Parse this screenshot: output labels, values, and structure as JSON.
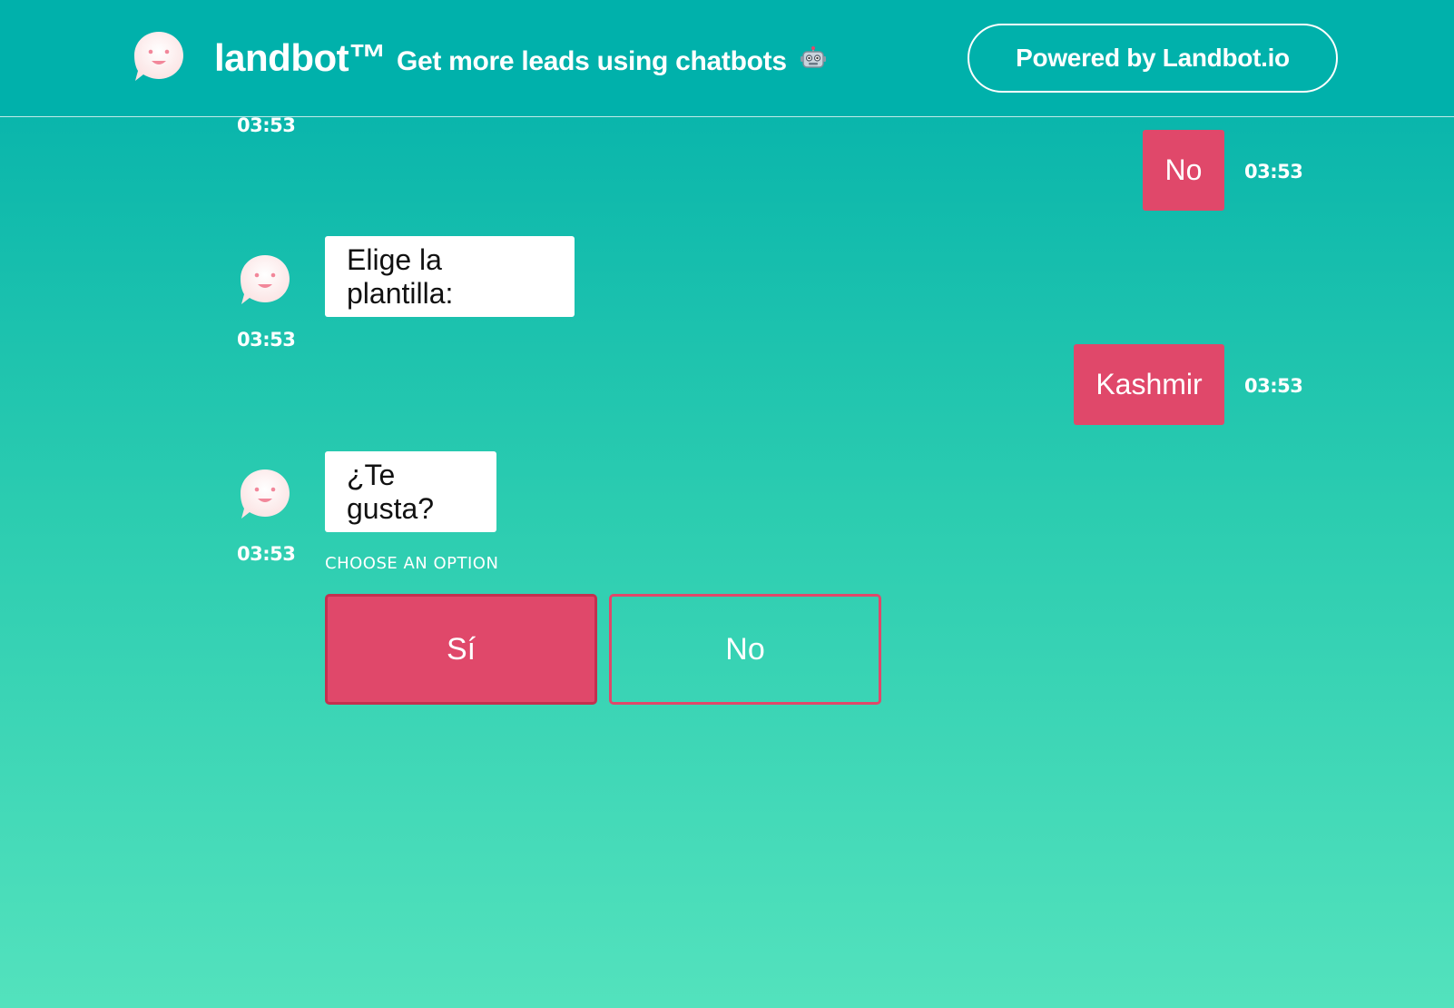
{
  "header": {
    "brand": "landbot™",
    "tagline": "Get more leads using chatbots",
    "tagline_icon": "robot-icon",
    "powered_label": "Powered by Landbot.io"
  },
  "messages": [
    {
      "from": "bot",
      "time": "03:53"
    },
    {
      "from": "user",
      "text": "No",
      "time": "03:53"
    },
    {
      "from": "bot",
      "text": "Elige la plantilla:",
      "time": "03:53"
    },
    {
      "from": "user",
      "text": "Kashmir",
      "time": "03:53"
    },
    {
      "from": "bot",
      "text": "¿Te gusta?",
      "time": "03:53"
    }
  ],
  "choices": {
    "label": "CHOOSE AN OPTION",
    "options": [
      "Sí",
      "No"
    ]
  },
  "colors": {
    "background_top": "#00afaa",
    "background_bottom": "#53e2bd",
    "user_bubble": "#e0486a",
    "bot_bubble": "#ffffff"
  }
}
